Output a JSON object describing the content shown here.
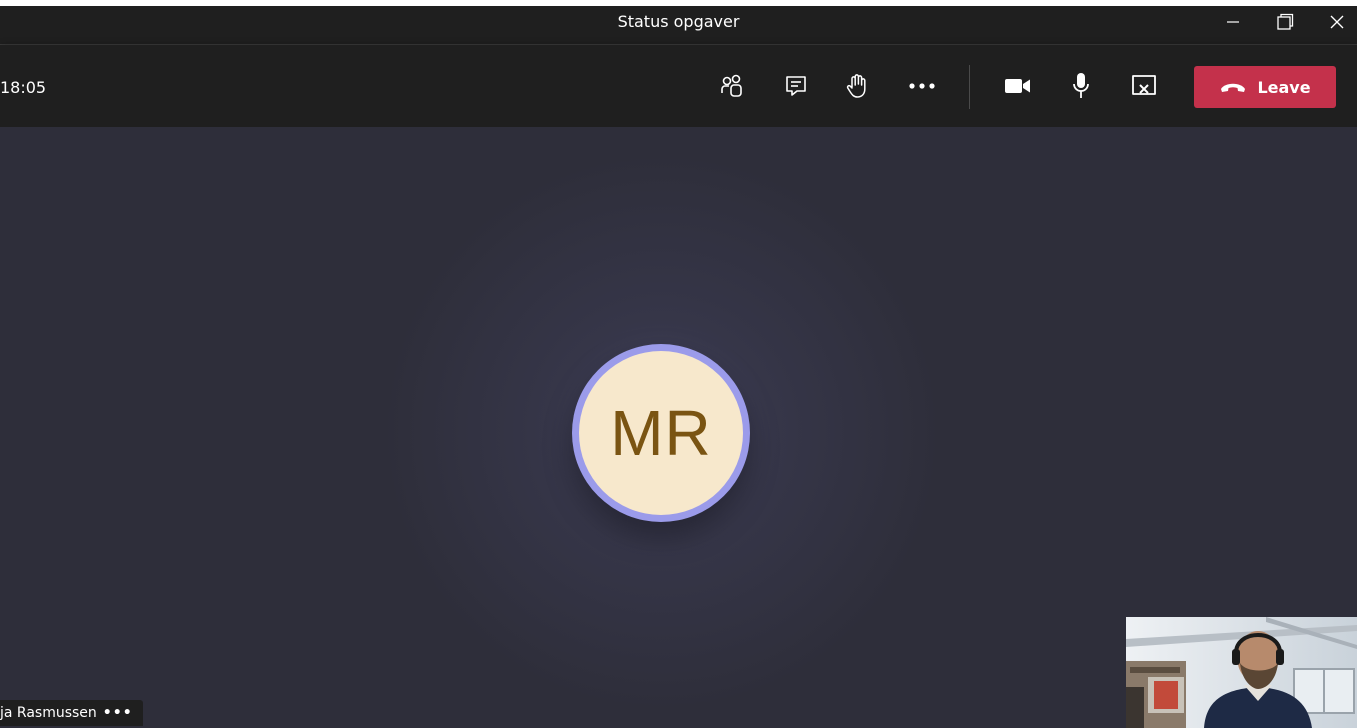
{
  "window": {
    "title": "Status opgaver"
  },
  "toolbar": {
    "timer": "18:05",
    "leave_label": "Leave"
  },
  "stage": {
    "avatar_initials": "MR",
    "participant_name": "ja Rasmussen",
    "participant_more": "•••"
  },
  "icons": {
    "participants": "people-icon",
    "chat": "chat-icon",
    "raise_hand": "hand-icon",
    "more": "more-icon",
    "camera": "video-camera-icon",
    "mic": "microphone-icon",
    "share": "share-screen-icon",
    "leave": "phone-hangup-icon"
  },
  "colors": {
    "toolbar_bg": "#1f1f1f",
    "stage_bg": "#2e2e3a",
    "leave_button": "#c4314b",
    "avatar_ring": "#9b9bea",
    "avatar_fill": "#f7e8cc",
    "avatar_text": "#7a5412"
  }
}
